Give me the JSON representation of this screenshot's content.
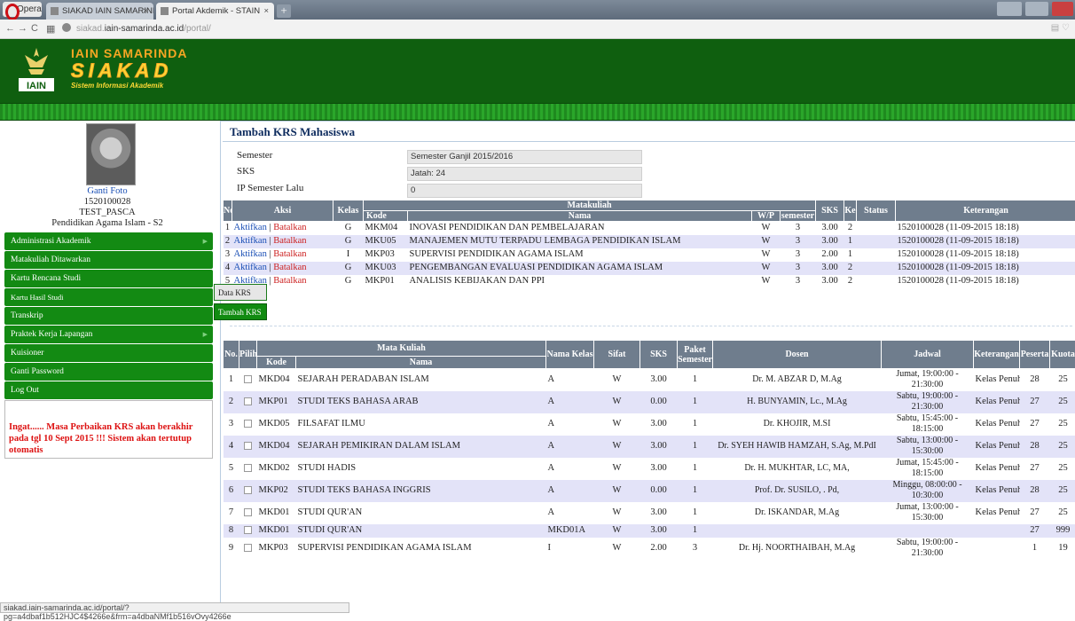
{
  "browser": {
    "app": "Opera",
    "tabs": [
      {
        "label": "SIAKAD IAIN SAMARINDA",
        "close": "×"
      },
      {
        "label": "Portal Akdemik - STAIN",
        "close": "×"
      }
    ],
    "new_tab": "+",
    "url_host": "siakad.iain-samarinda.ac.id",
    "url_path": "/portal/",
    "url_display_prefix": "siakad.",
    "url_display_domain": "iain-samarinda.ac.id",
    "status_url": "siakad.iain-samarinda.ac.id/portal/?pg=a4dbaf1b512HJC4$4266e&frm=a4dbaNMf1b516vOvy4266e"
  },
  "header": {
    "logo_text": "IAIN",
    "univ_name": "IAIN SAMARINDA",
    "app_name": "SIAKAD",
    "app_sub": "Sistem Informasi Akademik"
  },
  "profile": {
    "ganti_foto": "Ganti Foto",
    "nim": "1520100028",
    "username": "TEST_PASCA",
    "prodi": "Pendidikan Agama Islam - S2"
  },
  "menu": [
    {
      "label": "Administrasi Akademik",
      "arrow": true
    },
    {
      "label": "Matakuliah Ditawarkan",
      "arrow": false
    },
    {
      "label": "Kartu Rencana Studi",
      "arrow": false
    },
    {
      "label": "Kartu Hasil Studi",
      "arrow": false
    },
    {
      "label": "Transkrip",
      "arrow": false
    },
    {
      "label": "Praktek Kerja Lapangan",
      "arrow": true
    },
    {
      "label": "Kuisioner",
      "arrow": false
    },
    {
      "label": "Ganti Password",
      "arrow": false
    },
    {
      "label": "Log Out",
      "arrow": false
    }
  ],
  "submenu": {
    "data_krs": "Data KRS",
    "tambah_krs": "Tambah KRS"
  },
  "notice": "Ingat...... Masa Perbaikan KRS akan berakhir pada tgl 10 Sept 2015 !!! Sistem akan tertutup otomatis",
  "page": {
    "title": "Tambah KRS Mahasiswa",
    "semester_label": "Semester",
    "semester_value": "Semester Ganjil 2015/2016",
    "sks_label": "SKS",
    "sks_value": "Jatah: 24",
    "ip_label": "IP Semester Lalu",
    "ip_value": "0"
  },
  "krs_table": {
    "headers": {
      "no": "No",
      "aksi": "Aksi",
      "kelas": "Kelas",
      "matakuliah": "Matakuliah",
      "kode": "Kode",
      "nama": "Nama",
      "wp": "W/P",
      "semester": "semester",
      "sks": "SKS",
      "ke": "Ke",
      "status": "Status",
      "keterangan": "Keterangan"
    },
    "aktifkan": "Aktifkan",
    "batalkan": "Batalkan",
    "sep": " | ",
    "rows": [
      {
        "no": "1",
        "kelas": "G",
        "kode": "MKM04",
        "nama": "INOVASI PENDIDIKAN DAN PEMBELAJARAN",
        "wp": "W",
        "semester": "3",
        "sks": "3.00",
        "ke": "2",
        "status": "",
        "keterangan": "1520100028 (11-09-2015 18:18)"
      },
      {
        "no": "2",
        "kelas": "G",
        "kode": "MKU05",
        "nama": "MANAJEMEN MUTU TERPADU LEMBAGA PENDIDIKAN ISLAM",
        "wp": "W",
        "semester": "3",
        "sks": "3.00",
        "ke": "1",
        "status": "",
        "keterangan": "1520100028 (11-09-2015 18:18)"
      },
      {
        "no": "3",
        "kelas": "I",
        "kode": "MKP03",
        "nama": "SUPERVISI PENDIDIKAN AGAMA ISLAM",
        "wp": "W",
        "semester": "3",
        "sks": "2.00",
        "ke": "1",
        "status": "",
        "keterangan": "1520100028 (11-09-2015 18:18)"
      },
      {
        "no": "4",
        "kelas": "G",
        "kode": "MKU03",
        "nama": "PENGEMBANGAN EVALUASI PENDIDIKAN AGAMA ISLAM",
        "wp": "W",
        "semester": "3",
        "sks": "3.00",
        "ke": "2",
        "status": "",
        "keterangan": "1520100028 (11-09-2015 18:18)"
      },
      {
        "no": "5",
        "kelas": "G",
        "kode": "MKP01",
        "nama": "ANALISIS KEBIJAKAN DAN PPI",
        "wp": "W",
        "semester": "3",
        "sks": "3.00",
        "ke": "2",
        "status": "",
        "keterangan": "1520100028 (11-09-2015 18:18)"
      }
    ]
  },
  "mk_table": {
    "headers": {
      "no": "No.",
      "pilih": "Pilih",
      "mata_kuliah": "Mata Kuliah",
      "kode": "Kode",
      "nama": "Nama",
      "nama_kelas": "Nama Kelas",
      "sifat": "Sifat",
      "sks": "SKS",
      "paket": "Paket Semester",
      "dosen": "Dosen",
      "jadwal": "Jadwal",
      "keterangan": "Keterangan",
      "peserta": "Peserta",
      "kuota": "Kuota"
    },
    "rows": [
      {
        "no": "1",
        "kode": "MKD04",
        "nama": "SEJARAH PERADABAN ISLAM",
        "kelas": "A",
        "sifat": "W",
        "sks": "3.00",
        "paket": "1",
        "dosen": "Dr. M. ABZAR D, M.Ag",
        "jadwal": "Jumat, 19:00:00 - 21:30:00",
        "keterangan": "Kelas Penuh",
        "peserta": "28",
        "kuota": "25"
      },
      {
        "no": "2",
        "kode": "MKP01",
        "nama": "STUDI TEKS BAHASA ARAB",
        "kelas": "A",
        "sifat": "W",
        "sks": "0.00",
        "paket": "1",
        "dosen": "H. BUNYAMIN, Lc., M.Ag",
        "jadwal": "Sabtu, 19:00:00 - 21:30:00",
        "keterangan": "Kelas Penuh",
        "peserta": "27",
        "kuota": "25"
      },
      {
        "no": "3",
        "kode": "MKD05",
        "nama": "FILSAFAT ILMU",
        "kelas": "A",
        "sifat": "W",
        "sks": "3.00",
        "paket": "1",
        "dosen": "Dr. KHOJIR, M.SI",
        "jadwal": "Sabtu, 15:45:00 - 18:15:00",
        "keterangan": "Kelas Penuh",
        "peserta": "27",
        "kuota": "25"
      },
      {
        "no": "4",
        "kode": "MKD04",
        "nama": "SEJARAH PEMIKIRAN DALAM ISLAM",
        "kelas": "A",
        "sifat": "W",
        "sks": "3.00",
        "paket": "1",
        "dosen": "Dr. SYEH HAWIB HAMZAH, S.Ag, M.PdI",
        "jadwal": "Sabtu, 13:00:00 - 15:30:00",
        "keterangan": "Kelas Penuh",
        "peserta": "28",
        "kuota": "25"
      },
      {
        "no": "5",
        "kode": "MKD02",
        "nama": "STUDI HADIS",
        "kelas": "A",
        "sifat": "W",
        "sks": "3.00",
        "paket": "1",
        "dosen": "Dr. H. MUKHTAR, LC, MA,",
        "jadwal": "Jumat, 15:45:00 - 18:15:00",
        "keterangan": "Kelas Penuh",
        "peserta": "27",
        "kuota": "25"
      },
      {
        "no": "6",
        "kode": "MKP02",
        "nama": "STUDI TEKS BAHASA INGGRIS",
        "kelas": "A",
        "sifat": "W",
        "sks": "0.00",
        "paket": "1",
        "dosen": "Prof. Dr. SUSILO, . Pd,",
        "jadwal": "Minggu, 08:00:00 - 10:30:00",
        "keterangan": "Kelas Penuh",
        "peserta": "28",
        "kuota": "25"
      },
      {
        "no": "7",
        "kode": "MKD01",
        "nama": "STUDI QUR'AN",
        "kelas": "A",
        "sifat": "W",
        "sks": "3.00",
        "paket": "1",
        "dosen": "Dr. ISKANDAR, M.Ag",
        "jadwal": "Jumat, 13:00:00 - 15:30:00",
        "keterangan": "Kelas Penuh",
        "peserta": "27",
        "kuota": "25"
      },
      {
        "no": "8",
        "kode": "MKD01",
        "nama": "STUDI QUR'AN",
        "kelas": "MKD01A",
        "sifat": "W",
        "sks": "3.00",
        "paket": "1",
        "dosen": "",
        "jadwal": "",
        "keterangan": "",
        "peserta": "27",
        "kuota": "999"
      },
      {
        "no": "9",
        "kode": "MKP03",
        "nama": "SUPERVISI PENDIDIKAN AGAMA ISLAM",
        "kelas": "I",
        "sifat": "W",
        "sks": "2.00",
        "paket": "3",
        "dosen": "Dr. Hj. NOORTHAIBAH, M.Ag",
        "jadwal": "Sabtu, 19:00:00 - 21:30:00",
        "keterangan": "",
        "peserta": "1",
        "kuota": "19"
      }
    ]
  },
  "colors": {
    "header_green": "#0f5f0f",
    "menu_green": "#138a13",
    "table_header": "#6f7d8d",
    "alt_row": "#e3e3f8",
    "link_blue": "#1a4fb5",
    "link_red": "#cc1f1f",
    "notice_red": "#dd1111"
  }
}
